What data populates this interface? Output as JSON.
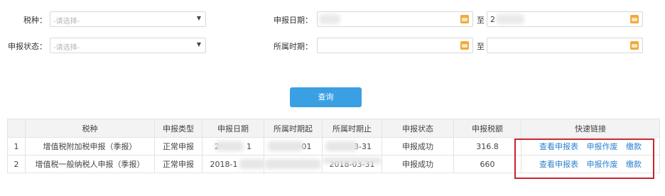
{
  "form": {
    "tax_type_label": "税种：",
    "tax_type_placeholder": "-请选择-",
    "declare_status_label": "申报状态：",
    "declare_status_placeholder": "-请选择-",
    "declare_date_label": "申报日期：",
    "period_label": "所属时期：",
    "to_label_1": "至",
    "to_label_2": "至",
    "declare_date_end_value": "2"
  },
  "query_button": "查询",
  "table": {
    "headers": [
      "",
      "税种",
      "申报类型",
      "申报日期",
      "所属时期起",
      "所属时期止",
      "申报状态",
      "申报税额",
      "快速链接"
    ],
    "rows": [
      {
        "index": "1",
        "tax_type": "增值税附加税申报（季报）",
        "declare_type": "正常申报",
        "declare_date": "2",
        "declare_date_tail": "1",
        "period_start": "-01",
        "period_end": "3-31",
        "status": "申报成功",
        "amount": "316.8",
        "links": [
          "查看申报表",
          "申报作废",
          "缴款"
        ]
      },
      {
        "index": "2",
        "tax_type": "增值税一般纳税人申报（季报）",
        "declare_type": "正常申报",
        "declare_date": "2018-1",
        "declare_date_tail": "",
        "period_start": "",
        "period_end": "2018-03-31",
        "status": "申报成功",
        "amount": "660",
        "links": [
          "查看申报表",
          "申报作废",
          "缴款"
        ]
      }
    ]
  },
  "colors": {
    "accent": "#3aa0e3",
    "link": "#2a82d0",
    "highlight_border": "#c6262b",
    "calendar_icon": "#f2a93b"
  }
}
